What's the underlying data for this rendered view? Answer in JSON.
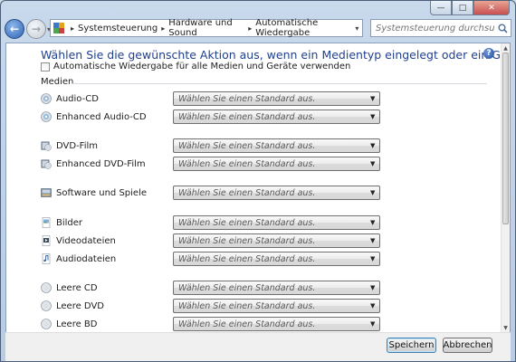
{
  "window": {
    "caption_min": "—",
    "caption_max": "□",
    "caption_close": "✕"
  },
  "nav": {
    "back_label": "←",
    "forward_label": "→",
    "dropdown_label": "▾",
    "breadcrumbs": [
      "Systemsteuerung",
      "Hardware und Sound",
      "Automatische Wiedergabe"
    ],
    "crumb_separator": "▸",
    "address_dropdown": "▾",
    "refresh_label": "↻",
    "search_placeholder": "Systemsteuerung durchsuchen"
  },
  "main": {
    "heading": "Wählen Sie die gewünschte Aktion aus, wenn ein Medientyp eingelegt oder ein Gerät angeschlossen wird.",
    "help_label": "?",
    "autoplay_all_label": "Automatische Wiedergabe für alle Medien und Geräte verwenden",
    "autoplay_all_checked": false,
    "group_label": "Medien",
    "select_placeholder": "Wählen Sie einen Standard aus.",
    "media": [
      {
        "label": "Audio-CD",
        "icon": "audio-cd-icon",
        "value": "Wählen Sie einen Standard aus."
      },
      {
        "label": "Enhanced Audio-CD",
        "icon": "enhanced-audio-cd-icon",
        "value": "Wählen Sie einen Standard aus."
      },
      {
        "label": "DVD-Film",
        "icon": "dvd-film-icon",
        "value": "Wählen Sie einen Standard aus."
      },
      {
        "label": "Enhanced DVD-Film",
        "icon": "enhanced-dvd-film-icon",
        "value": "Wählen Sie einen Standard aus."
      },
      {
        "label": "Software und Spiele",
        "icon": "software-icon",
        "value": "Wählen Sie einen Standard aus."
      },
      {
        "label": "Bilder",
        "icon": "pictures-icon",
        "value": "Wählen Sie einen Standard aus."
      },
      {
        "label": "Videodateien",
        "icon": "video-files-icon",
        "value": "Wählen Sie einen Standard aus."
      },
      {
        "label": "Audiodateien",
        "icon": "audio-files-icon",
        "value": "Wählen Sie einen Standard aus."
      },
      {
        "label": "Leere CD",
        "icon": "blank-cd-icon",
        "value": "Wählen Sie einen Standard aus."
      },
      {
        "label": "Leere DVD",
        "icon": "blank-dvd-icon",
        "value": "Wählen Sie einen Standard aus."
      },
      {
        "label": "Leere BD",
        "icon": "blank-bd-icon",
        "value": "Wählen Sie einen Standard aus."
      }
    ]
  },
  "footer": {
    "save_label": "Speichern",
    "cancel_label": "Abbrechen"
  },
  "colors": {
    "heading": "#1f3f8f",
    "frame": "#c9d9ec"
  }
}
